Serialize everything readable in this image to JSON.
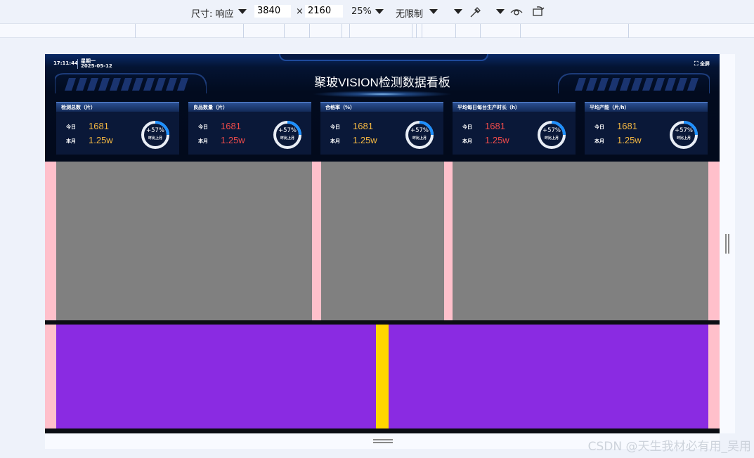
{
  "devtools": {
    "dimension_label": "尺寸: 响应",
    "width": "3840",
    "times": "×",
    "height": "2160",
    "zoom": "25%",
    "throttle": "无限制"
  },
  "dashboard": {
    "time": "17:11:44",
    "weekday": "星期一",
    "date": "2025-05-12",
    "fullscreen": "全屏",
    "title": "聚玻VISION检测数据看板",
    "cards": [
      {
        "title": "检测总数（片）",
        "today_label": "今日",
        "today": "1681",
        "month_label": "本月",
        "month": "1.25w",
        "ratio": "+57%",
        "ratio_label": "环比上月",
        "ratio_fraction": 0.25,
        "today_color": "gold",
        "month_color": "gold"
      },
      {
        "title": "良品数量（片）",
        "today_label": "今日",
        "today": "1681",
        "month_label": "本月",
        "month": "1.25w",
        "ratio": "+57%",
        "ratio_label": "环比上月",
        "ratio_fraction": 0.25,
        "today_color": "red",
        "month_color": "red"
      },
      {
        "title": "合格率（%）",
        "today_label": "今日",
        "today": "1681",
        "month_label": "本月",
        "month": "1.25w",
        "ratio": "+57%",
        "ratio_label": "环比上月",
        "ratio_fraction": 0.25,
        "today_color": "gold",
        "month_color": "gold"
      },
      {
        "title": "平均每日每台生产时长（h）",
        "today_label": "今日",
        "today": "1681",
        "month_label": "本月",
        "month": "1.25w",
        "ratio": "+57%",
        "ratio_label": "环比上月",
        "ratio_fraction": 0.25,
        "today_color": "red",
        "month_color": "red"
      },
      {
        "title": "平均产能（片/h）",
        "today_label": "今日",
        "today": "1681",
        "month_label": "本月",
        "month": "1.25w",
        "ratio": "+57%",
        "ratio_label": "环比上月",
        "ratio_fraction": 0.25,
        "today_color": "gold",
        "month_color": "gold"
      }
    ],
    "colors": {
      "gold": "#f5b942",
      "red": "#ef4b4b",
      "ring_track": "#e8edf5",
      "ring_fill": "#1e90ff"
    }
  },
  "watermark": "CSDN @天生我材必有用_吴用"
}
